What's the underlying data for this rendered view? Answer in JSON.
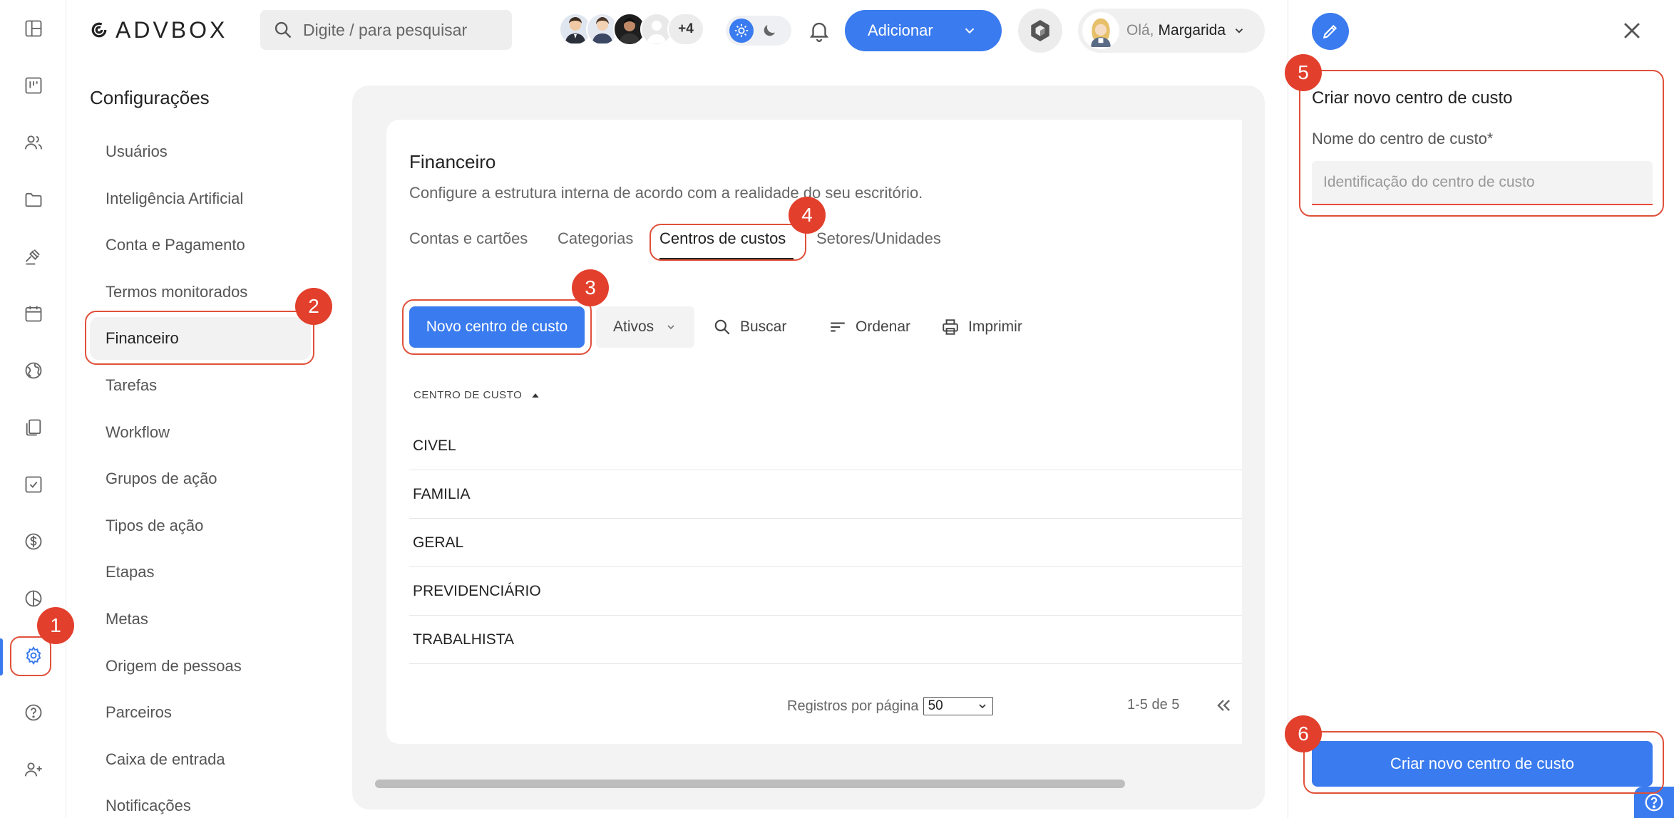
{
  "header": {
    "logo_text": "ADVBOX",
    "search_placeholder": "Digite / para pesquisar",
    "avatars_more": "+4",
    "add_button": "Adicionar",
    "greeting": "Olá,",
    "user_name": "Margarida"
  },
  "rail": {
    "items": [
      "dashboard-icon",
      "kanban-icon",
      "people-icon",
      "folder-icon",
      "gavel-icon",
      "calendar-icon",
      "globe-icon",
      "documents-icon",
      "checkbox-icon",
      "dollar-icon",
      "pie-chart-icon",
      "gear-icon",
      "help-icon",
      "add-user-icon"
    ],
    "active": "gear-icon"
  },
  "settings": {
    "title": "Configurações",
    "items": [
      "Usuários",
      "Inteligência Artificial",
      "Conta e Pagamento",
      "Termos monitorados",
      "Financeiro",
      "Tarefas",
      "Workflow",
      "Grupos de ação",
      "Tipos de ação",
      "Etapas",
      "Metas",
      "Origem de pessoas",
      "Parceiros",
      "Caixa de entrada",
      "Notificações"
    ],
    "active_item": "Financeiro"
  },
  "main": {
    "title": "Financeiro",
    "subtitle": "Configure a estrutura interna de acordo com a realidade do seu escritório.",
    "tabs": [
      "Contas e cartões",
      "Categorias",
      "Centros de custos",
      "Setores/Unidades"
    ],
    "active_tab": "Centros de custos",
    "new_button": "Novo centro de custo",
    "status_filter": "Ativos",
    "search_label": "Buscar",
    "sort_label": "Ordenar",
    "print_label": "Imprimir",
    "column_header": "CENTRO DE CUSTO",
    "rows": [
      "CIVEL",
      "FAMILIA",
      "GERAL",
      "PREVIDENCIÁRIO",
      "TRABALHISTA"
    ],
    "pager": {
      "per_page_label": "Registros por página",
      "per_page_value": "50",
      "range": "1-5 de 5"
    }
  },
  "panel": {
    "title": "Criar novo centro de custo",
    "field_label": "Nome do centro de custo*",
    "field_placeholder": "Identificação do centro de custo",
    "field_value": "",
    "submit_button": "Criar novo centro de custo"
  },
  "annotations": [
    "1",
    "2",
    "3",
    "4",
    "5",
    "6"
  ],
  "colors": {
    "accent": "#3a7bef",
    "annotation": "#e23f2c",
    "content_bg": "#f3f3f3"
  }
}
